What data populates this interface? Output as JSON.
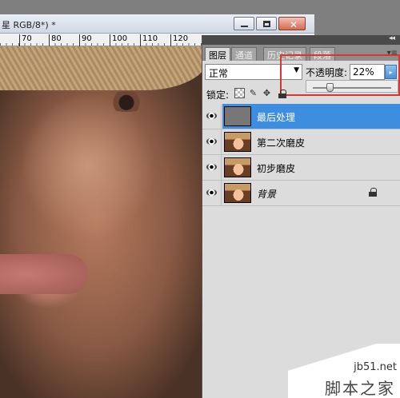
{
  "document": {
    "title": "星 RGB/8*) *",
    "ruler_labels": [
      "70",
      "80",
      "90",
      "100",
      "110",
      "120"
    ]
  },
  "layers_panel": {
    "tabs": [
      {
        "label": "图层",
        "active": true
      },
      {
        "label": "通道",
        "active": false
      },
      {
        "label": "历史记录",
        "active": false
      },
      {
        "label": "段落",
        "active": false
      }
    ],
    "blend_mode": "正常",
    "opacity_label": "不透明度:",
    "opacity_value": "22%",
    "opacity_slider_fraction": 0.22,
    "lock_label": "锁定:",
    "layers": [
      {
        "name": "最后处理",
        "selected": true,
        "thumbnail": "gray",
        "locked": false,
        "italic": false
      },
      {
        "name": "第二次磨皮",
        "selected": false,
        "thumbnail": "photo",
        "locked": false,
        "italic": false
      },
      {
        "name": "初步磨皮",
        "selected": false,
        "thumbnail": "photo",
        "locked": false,
        "italic": false
      },
      {
        "name": "背景",
        "selected": false,
        "thumbnail": "photo",
        "locked": true,
        "italic": true
      }
    ]
  },
  "watermark": {
    "url": "jb51.net",
    "name": "脚本之家"
  },
  "colors": {
    "highlight_box": "#d9362c",
    "selected_layer": "#3d8ee0"
  }
}
